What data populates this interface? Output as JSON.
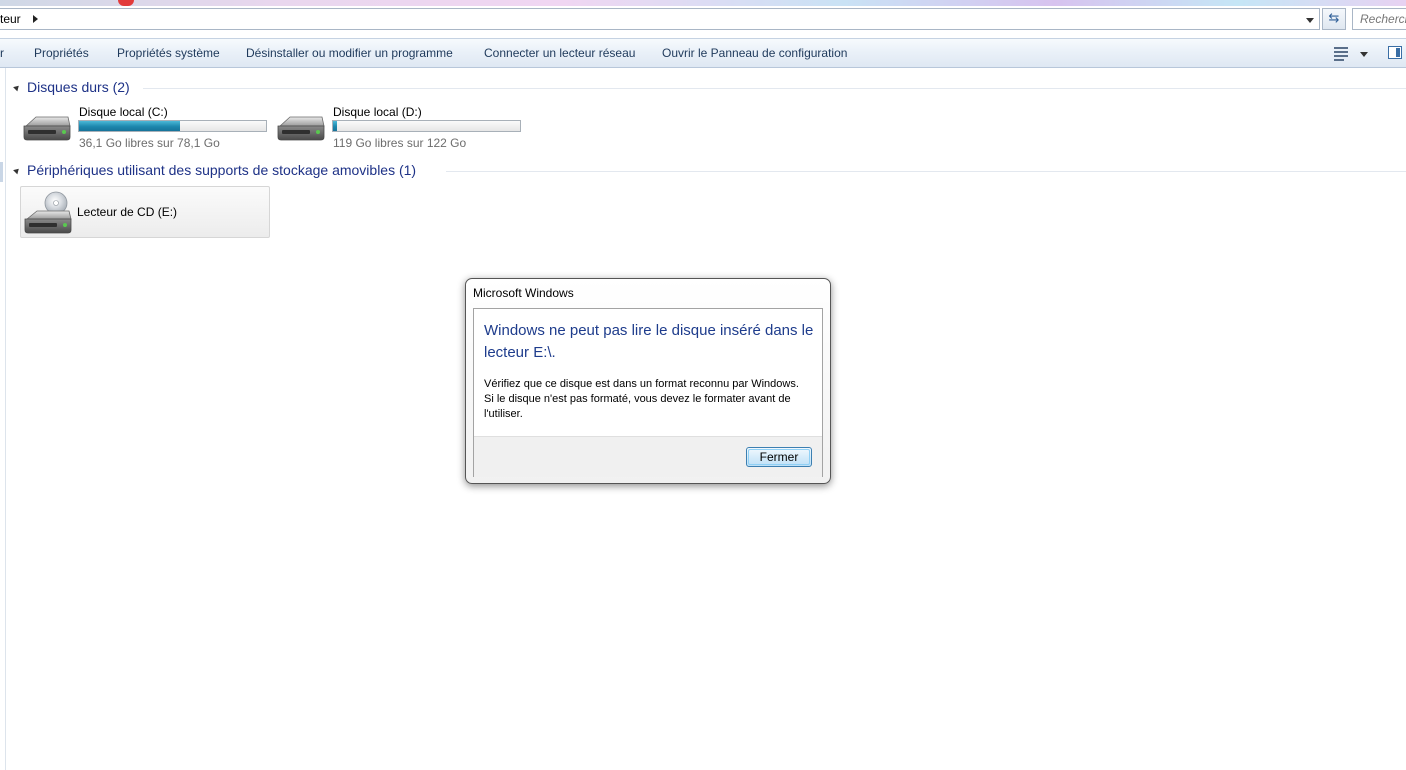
{
  "address_bar": {
    "path_text": "teur",
    "search_placeholder": "Recherch"
  },
  "toolbar": {
    "items": [
      {
        "label": "r"
      },
      {
        "label": "Propriétés"
      },
      {
        "label": "Propriétés système"
      },
      {
        "label": "Désinstaller ou modifier un programme"
      },
      {
        "label": "Connecter un lecteur réseau"
      },
      {
        "label": "Ouvrir le Panneau de configuration"
      }
    ]
  },
  "groups": {
    "hard_drives": {
      "title": "Disques durs (2)",
      "drives": [
        {
          "name": "Disque local (C:)",
          "free_text": "36,1 Go libres sur 78,1 Go",
          "used_fraction": 0.54
        },
        {
          "name": "Disque local (D:)",
          "free_text": "119 Go libres sur 122 Go",
          "used_fraction": 0.02
        }
      ]
    },
    "removable": {
      "title": "Périphériques utilisant des supports de stockage amovibles (1)",
      "devices": [
        {
          "name": "Lecteur de CD (E:)"
        }
      ]
    }
  },
  "dialog": {
    "title": "Microsoft Windows",
    "main_message": "Windows ne peut pas lire le disque inséré dans le lecteur E:\\.",
    "detail_message": "Vérifiez que ce disque est dans un format reconnu par Windows. Si le disque n'est pas formaté, vous devez le formater avant de l'utiliser.",
    "close_button": "Fermer"
  },
  "colors": {
    "accent_text": "#1e3287",
    "drive_bar": "#1d87ad",
    "toolbar_text": "#1e395b"
  },
  "icons": {
    "hard_drive": "hard-drive-icon",
    "cd_drive": "cd-drive-icon",
    "refresh": "refresh-icon",
    "views": "view-options-icon",
    "preview_pane": "preview-pane-icon"
  }
}
